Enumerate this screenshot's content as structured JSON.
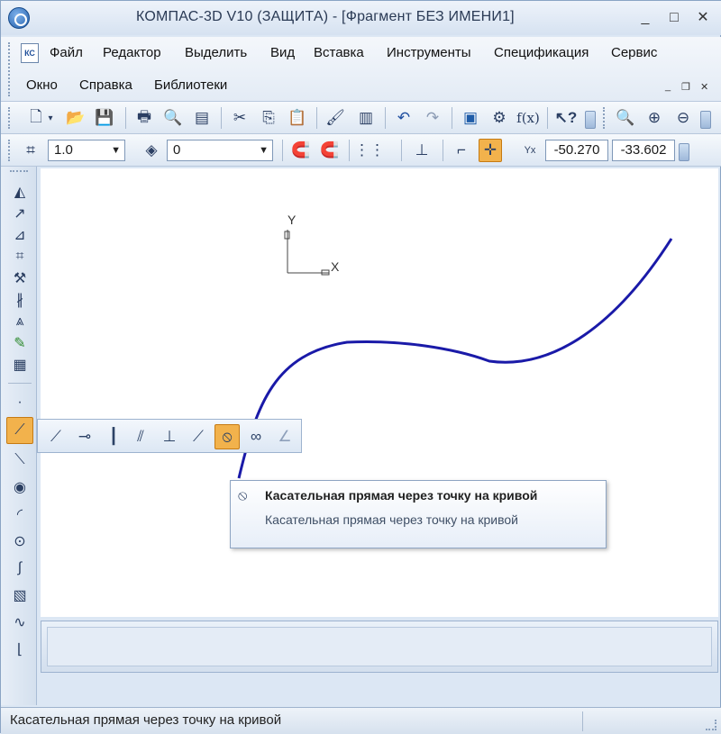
{
  "window": {
    "title": "КОМПАС-3D V10 (ЗАЩИТА) - [Фрагмент БЕЗ ИМЕНИ1]",
    "minimize": "_",
    "maximize": "□",
    "close": "✕"
  },
  "menu": {
    "items_row1": [
      "Файл",
      "Редактор",
      "Выделить",
      "Вид",
      "Вставка",
      "Инструменты",
      "Спецификация",
      "Сервис"
    ],
    "items_row2": [
      "Окно",
      "Справка",
      "Библиотеки"
    ],
    "doc_icon_label": "КС",
    "mdi_minimize": "_",
    "mdi_restore": "❐",
    "mdi_close": "✕"
  },
  "current_params": {
    "scale_value": "1.0",
    "layer_value": "0",
    "coord_x": "-50.270",
    "coord_y": "-33.602",
    "coord_label": "Yx"
  },
  "axes": {
    "x_label": "X",
    "y_label": "Y"
  },
  "tooltip": {
    "title": "Касательная прямая через точку на кривой",
    "description": "Касательная прямая через точку на кривой"
  },
  "status": {
    "text": "Касательная прямая через точку на кривой"
  },
  "colors": {
    "curve": "#1a1aa8",
    "active_tool": "#f2b24c",
    "background": "#dce7f4"
  },
  "icons": {
    "standard_toolbar": [
      "new-document-icon",
      "dropdown-arrow-icon",
      "open-folder-icon",
      "save-icon",
      "print-icon",
      "print-preview-icon",
      "page-setup-icon",
      "cut-icon",
      "copy-icon",
      "paste-icon",
      "format-brush-icon",
      "library-icon",
      "undo-icon",
      "redo-icon",
      "manager-icon",
      "tools-icon",
      "function-icon",
      "help-icon",
      "zoom-icon",
      "zoom-in-icon",
      "zoom-out-icon"
    ],
    "flyout_tools": [
      "horizontal-line-icon",
      "horizontal-point-line-icon",
      "vertical-line-icon",
      "parallel-line-icon",
      "perpendicular-line-icon",
      "tangent-external-icon",
      "tangent-point-icon",
      "tangent-two-curves-icon",
      "bisector-icon"
    ]
  }
}
